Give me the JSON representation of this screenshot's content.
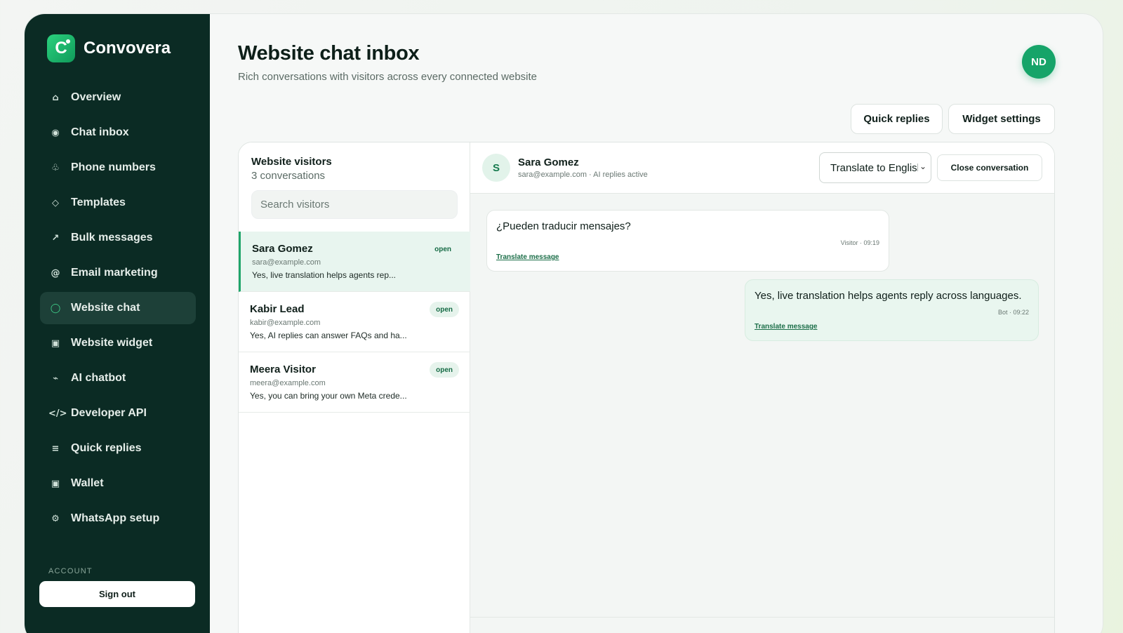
{
  "brand": {
    "name": "Convovera",
    "logo_letter": "C"
  },
  "nav": [
    {
      "icon": "home-icon",
      "glyph": "⌂",
      "label": "Overview",
      "active": false
    },
    {
      "icon": "chat-icon",
      "glyph": "◉",
      "label": "Chat inbox",
      "active": false
    },
    {
      "icon": "phone-icon",
      "glyph": "♧",
      "label": "Phone numbers",
      "active": false
    },
    {
      "icon": "template-icon",
      "glyph": "◇",
      "label": "Templates",
      "active": false
    },
    {
      "icon": "arrow-icon",
      "glyph": "↗",
      "label": "Bulk messages",
      "active": false
    },
    {
      "icon": "at-icon",
      "glyph": "@",
      "label": "Email marketing",
      "active": false
    },
    {
      "icon": "circle-icon",
      "glyph": "◯",
      "label": "Website chat",
      "active": true
    },
    {
      "icon": "widget-icon",
      "glyph": "▣",
      "label": "Website widget",
      "active": false
    },
    {
      "icon": "bot-icon",
      "glyph": "⌁",
      "label": "AI chatbot",
      "active": false
    },
    {
      "icon": "code-icon",
      "glyph": "</>",
      "label": "Developer API",
      "active": false
    },
    {
      "icon": "list-icon",
      "glyph": "≡",
      "label": "Quick replies",
      "active": false
    },
    {
      "icon": "wallet-icon",
      "glyph": "▣",
      "label": "Wallet",
      "active": false
    },
    {
      "icon": "gear-icon",
      "glyph": "⚙",
      "label": "WhatsApp setup",
      "active": false
    }
  ],
  "account": {
    "label": "ACCOUNT",
    "signout": "Sign out"
  },
  "header": {
    "title": "Website chat inbox",
    "subtitle": "Rich conversations with visitors across every connected website",
    "avatar": "ND",
    "quick_replies": "Quick replies",
    "widget_settings": "Widget settings"
  },
  "list": {
    "title": "Website visitors",
    "count": "3 conversations",
    "search_placeholder": "Search visitors",
    "conversations": [
      {
        "name": "Sara Gomez",
        "email": "sara@example.com",
        "preview": "Yes, live translation helps agents rep...",
        "status": "open"
      },
      {
        "name": "Kabir Lead",
        "email": "kabir@example.com",
        "preview": "Yes, AI replies can answer FAQs and ha...",
        "status": "open"
      },
      {
        "name": "Meera Visitor",
        "email": "meera@example.com",
        "preview": "Yes, you can bring your own Meta crede...",
        "status": "open"
      }
    ]
  },
  "chat": {
    "avatar": "S",
    "name": "Sara Gomez",
    "meta": "sara@example.com · AI replies active",
    "translate": "Translate to English",
    "close": "Close conversation",
    "messages": [
      {
        "text": "¿Pueden traducir mensajes?",
        "time": "Visitor · 09:19",
        "link": "Translate message"
      },
      {
        "text": "Yes, live translation helps agents reply across languages.",
        "time": "Bot · 09:22",
        "link": "Translate message"
      }
    ]
  },
  "colors": {
    "sidebar": "#0b2b24",
    "accent": "#16a469",
    "active_nav": "#1d4038"
  }
}
